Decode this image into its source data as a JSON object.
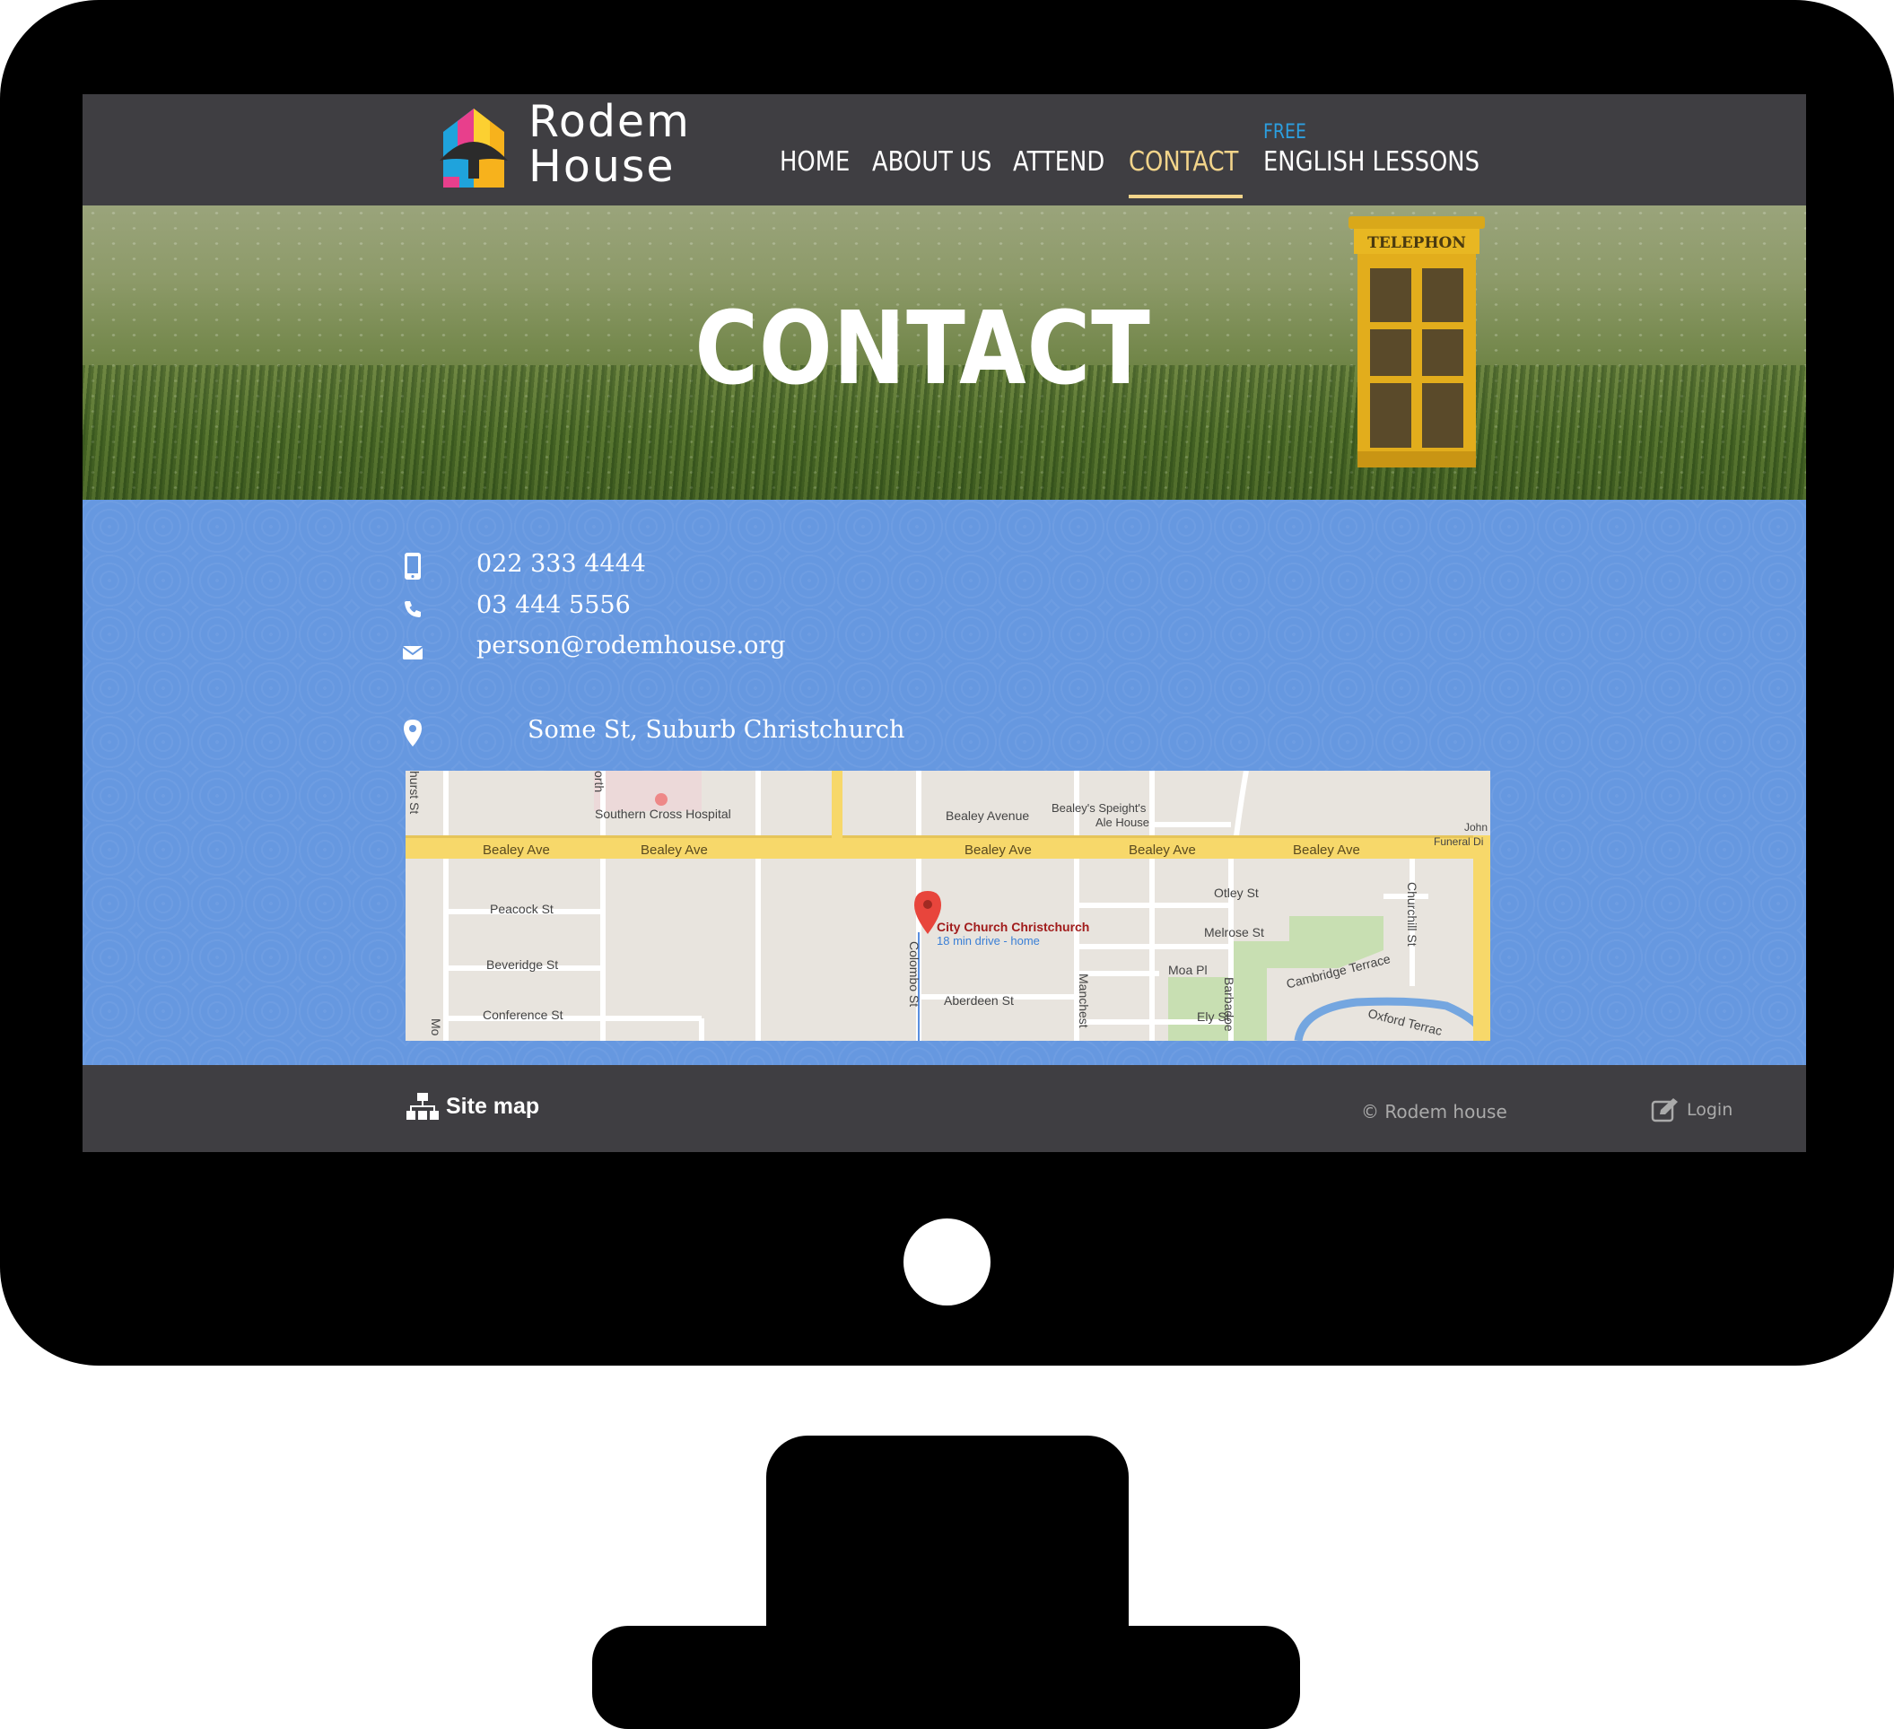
{
  "brand": {
    "name_line1": "Rodem",
    "name_line2": "House"
  },
  "nav": {
    "items": [
      {
        "label": "HOME"
      },
      {
        "label": "ABOUT US"
      },
      {
        "label": "ATTEND"
      },
      {
        "label": "CONTACT",
        "active": true
      },
      {
        "label": "ENGLISH LESSONS",
        "badge": "FREE"
      }
    ]
  },
  "hero": {
    "title": "CONTACT",
    "booth_sign": "TELEPHON"
  },
  "contact": {
    "mobile": "022 333 4444",
    "phone": "03 444 5556",
    "email": "person@rodemhouse.org",
    "address": "Some St, Suburb Christchurch"
  },
  "map": {
    "place_name": "City Church Christchurch",
    "place_sub": "18 min drive - home",
    "labels": {
      "hospital": "Southern Cross Hospital",
      "bealey_avenue": "Bealey Avenue",
      "speights": "Bealey's Speight's",
      "speights2": "Ale House",
      "john": "John",
      "funeral": "Funeral Di",
      "bealey": "Bealey Ave",
      "peacock": "Peacock St",
      "beveridge": "Beveridge St",
      "conference": "Conference St",
      "colombo": "Colombo St",
      "manchester": "Manchest",
      "otley": "Otley St",
      "melrose": "Melrose St",
      "moa": "Moa Pl",
      "aberdeen": "Aberdeen St",
      "ely": "Ely St",
      "barbadoes": "Barbadoe",
      "churchill": "Churchill St",
      "cambridge": "Cambridge Terrace",
      "oxford": "Oxford Terrac",
      "hurst": "hurst St",
      "north": "orth",
      "mo": "Mo"
    }
  },
  "footer": {
    "sitemap": "Site map",
    "copyright": "© Rodem house",
    "login": "Login"
  },
  "colors": {
    "header_bg": "#3f3e42",
    "active_nav": "#f2d48a",
    "free_badge": "#2c9fe0",
    "contact_bg": "#6698e0"
  }
}
